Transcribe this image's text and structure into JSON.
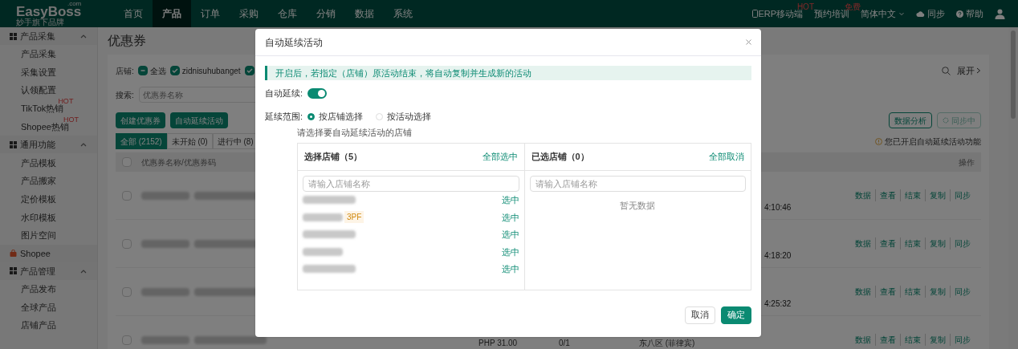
{
  "logo": {
    "name": "EasyBoss",
    "domain": ".com",
    "tagline": "妙手旗下品牌"
  },
  "nav": [
    {
      "label": "首页",
      "selected": false
    },
    {
      "label": "产品",
      "selected": true
    },
    {
      "label": "订单",
      "selected": false
    },
    {
      "label": "采购",
      "selected": false
    },
    {
      "label": "仓库",
      "selected": false
    },
    {
      "label": "分销",
      "selected": false
    },
    {
      "label": "数据",
      "selected": false
    },
    {
      "label": "系统",
      "selected": false
    }
  ],
  "header_links": [
    {
      "kind": "mobile",
      "label": "ERP移动端",
      "badge": "HOT"
    },
    {
      "kind": "plain",
      "label": "预约培训",
      "badge": "免费"
    },
    {
      "kind": "language",
      "label": "简体中文"
    },
    {
      "kind": "sync",
      "label": "同步"
    },
    {
      "kind": "help",
      "label": "帮助"
    },
    {
      "kind": "user"
    }
  ],
  "sidebar": [
    {
      "kind": "group",
      "label": "产品采集",
      "expanded": true,
      "children": [
        {
          "label": "产品采集"
        },
        {
          "label": "采集设置"
        },
        {
          "label": "认领配置"
        },
        {
          "label": "TikTok热销",
          "badge": "HOT"
        },
        {
          "label": "Shopee热销",
          "badge": "HOT"
        }
      ]
    },
    {
      "kind": "group",
      "label": "通用功能",
      "expanded": true,
      "children": [
        {
          "label": "产品模板"
        },
        {
          "label": "产品搬家"
        },
        {
          "label": "定价模板"
        },
        {
          "label": "水印模板"
        },
        {
          "label": "图片空间"
        }
      ]
    },
    {
      "kind": "platform",
      "label": "Shopee"
    },
    {
      "kind": "group",
      "label": "产品管理",
      "expanded": true,
      "children": [
        {
          "label": "产品发布"
        },
        {
          "label": "全球产品"
        },
        {
          "label": "店铺产品"
        }
      ]
    }
  ],
  "page_title": "优惠券",
  "filters": {
    "store_label": "店铺:",
    "stores": [
      {
        "label": "全选",
        "checked": true,
        "indeterminate": true
      },
      {
        "label": "zidnisuhubanget",
        "checked": true
      },
      {
        "checked": true
      }
    ],
    "expand": "展开",
    "search_label": "搜索:",
    "search_placeholder": "优惠券名称"
  },
  "actions": [
    "创建优惠券",
    "自动延续活动"
  ],
  "right_actions": [
    {
      "label": "数据分析",
      "disabled": false
    },
    {
      "label": "同步中",
      "disabled": true
    }
  ],
  "tabs": [
    {
      "label": "全部 (2152)",
      "selected": true
    },
    {
      "label": "未开始 (0)",
      "selected": false
    },
    {
      "label": "进行中 (8)",
      "selected": false
    }
  ],
  "notice": "您已开启自动延续活动功能",
  "table": {
    "columns": [
      "优惠券名称/优惠券码",
      "操作"
    ],
    "header_checked": false,
    "rows": [
      {
        "checked": false,
        "time": "4:10:46",
        "actions": [
          "数据",
          "查看",
          "结束",
          "复制",
          "同步"
        ]
      },
      {
        "checked": false,
        "time": "4:18:20",
        "actions": [
          "数据",
          "查看",
          "结束",
          "复制",
          "同步"
        ]
      },
      {
        "checked": false,
        "time": "4:25:32",
        "actions": [
          "数据",
          "查看",
          "结束",
          "复制",
          "同步"
        ]
      },
      {
        "checked": false,
        "price": "PHP 31.00",
        "usage": "0/1",
        "timezone": "东八区 (菲律宾)",
        "actions": [
          "数据",
          "查看",
          "结束",
          "复制",
          "同步"
        ]
      }
    ]
  },
  "dialog": {
    "title": "自动延续活动",
    "alert": "开启后，若指定（店铺）原活动结束，将自动复制并生成新的活动",
    "toggle_label": "自动延续:",
    "toggle_on": true,
    "scope_label": "延续范围:",
    "scope_options": [
      {
        "label": "按店铺选择",
        "selected": true
      },
      {
        "label": "按活动选择",
        "selected": false
      }
    ],
    "hint": "请选择要自动延续活动的店铺",
    "left_panel": {
      "title": "选择店铺（5）",
      "action": "全部选中",
      "placeholder": "请输入店铺名称",
      "items": [
        {
          "action": "选中"
        },
        {
          "tag": "3PF",
          "action": "选中"
        },
        {
          "action": "选中"
        },
        {
          "action": "选中"
        },
        {
          "action": "选中"
        }
      ]
    },
    "right_panel": {
      "title": "已选店铺（0）",
      "action": "全部取消",
      "placeholder": "请输入店铺名称",
      "empty": "暂无数据"
    },
    "buttons": [
      {
        "kind": "secondary",
        "label": "取消"
      },
      {
        "kind": "primary",
        "label": "确定"
      }
    ]
  }
}
